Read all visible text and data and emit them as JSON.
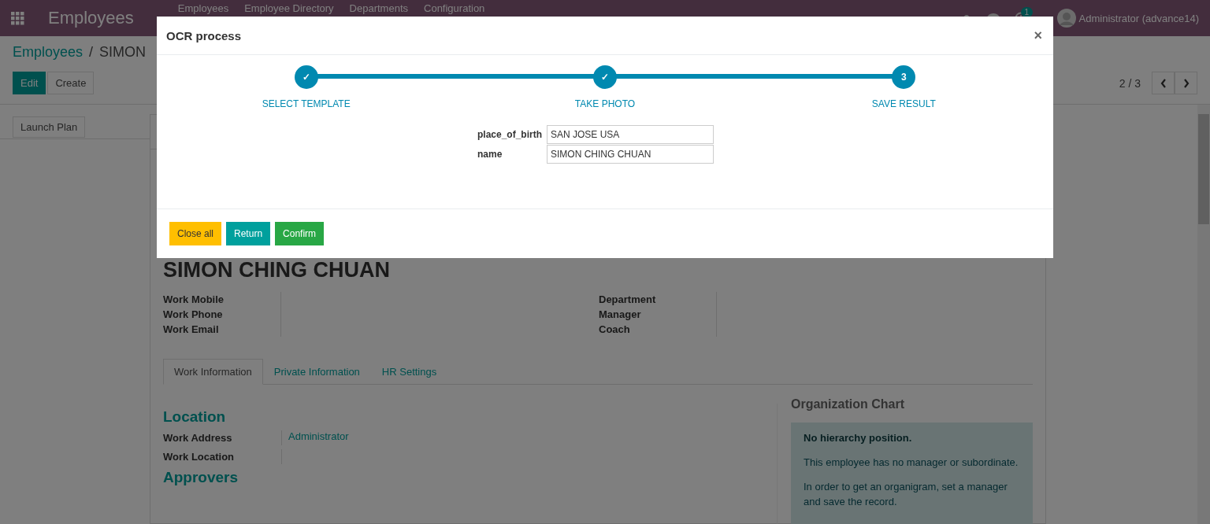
{
  "navbar": {
    "app_title": "Employees",
    "menu": [
      "Employees",
      "Employee Directory",
      "Departments",
      "Configuration"
    ],
    "activity_badge": "1",
    "user": "Administrator (advance14)"
  },
  "control_panel": {
    "breadcrumb": [
      {
        "label": "Employees",
        "kind": "link"
      },
      {
        "label": "SIMON",
        "kind": "current"
      }
    ],
    "breadcrumb_separator": "/",
    "buttons": [
      {
        "label": "Edit",
        "kind": "primary"
      },
      {
        "label": "Create",
        "kind": "secondary"
      }
    ],
    "pager": "2 / 3"
  },
  "form": {
    "header_buttons": [
      "Launch Plan"
    ],
    "employee_name": "SIMON CHING CHUAN",
    "left_fields": [
      "Work Mobile",
      "Work Phone",
      "Work Email"
    ],
    "right_fields": [
      "Department",
      "Manager",
      "Coach"
    ],
    "tabs": [
      {
        "label": "Work Information",
        "selected": true
      },
      {
        "label": "Private Information",
        "selected": false
      },
      {
        "label": "HR Settings",
        "selected": false
      }
    ],
    "location": {
      "title": "Location",
      "fields": [
        {
          "label": "Work Address",
          "value": "Administrator"
        },
        {
          "label": "Work Location"
        }
      ]
    },
    "approvers_title": "Approvers",
    "org_chart": {
      "title": "Organization Chart",
      "heading": "No hierarchy position.",
      "paragraphs": [
        "This employee has no manager or subordinate.",
        "In order to get an organigram, set a manager and save the record."
      ]
    }
  },
  "dialog": {
    "title": "OCR process",
    "close_glyph": "×",
    "steps": [
      {
        "label": "SELECT TEMPLATE",
        "marker": "✓"
      },
      {
        "label": "TAKE PHOTO",
        "marker": "✓"
      },
      {
        "label": "SAVE RESULT",
        "marker": "3"
      }
    ],
    "fields": [
      {
        "label": "place_of_birth",
        "value": "SAN JOSE USA"
      },
      {
        "label": "name",
        "value": "SIMON CHING CHUAN"
      }
    ],
    "buttons": [
      {
        "label": "Close all",
        "kind": "warning"
      },
      {
        "label": "Return",
        "kind": "info"
      },
      {
        "label": "Confirm",
        "kind": "success"
      }
    ]
  }
}
